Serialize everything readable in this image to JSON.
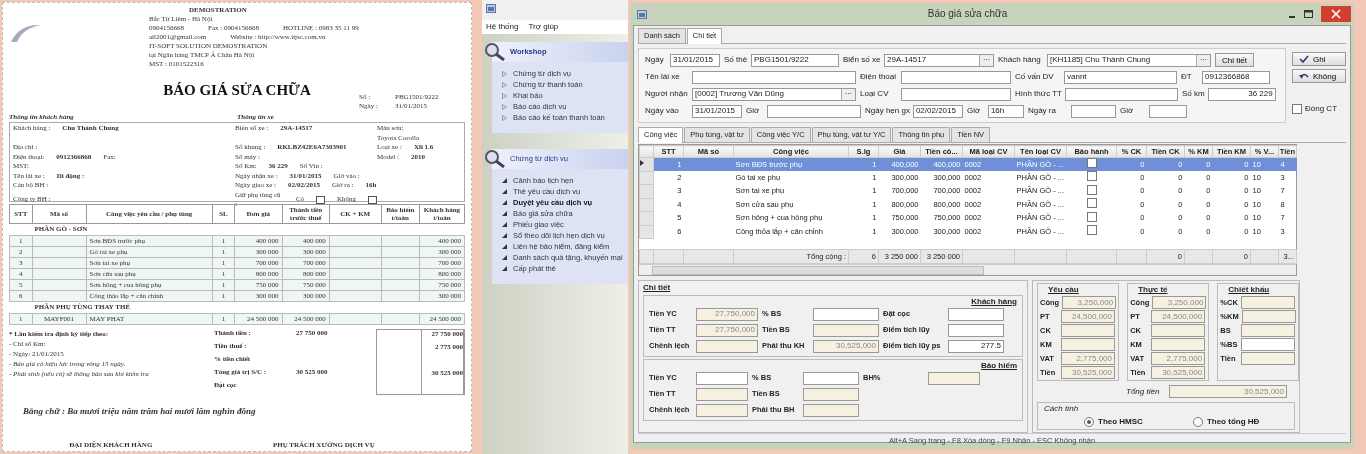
{
  "document": {
    "company_rows": [
      [
        "DEMOSTRATION"
      ],
      [
        "Bắc Từ Liêm - Hà Nội"
      ],
      [
        "0904156668",
        "Fax : 0904156668",
        "HOTLINE : 0983 35 11 99"
      ],
      [
        "ail2001@gmail.com",
        "Website : http://www.itjsc.com.vn"
      ],
      [
        "IT-SOFT SOLUTION DEMOSTRATION"
      ],
      [
        "tại Ngân hàng TMCP Á Châu Hà Nội"
      ],
      [
        "MST : 0101522316"
      ]
    ],
    "title": "BÁO GIÁ SỬA CHỮA",
    "meta": [
      [
        "Số :",
        "PBG1501/9222"
      ],
      [
        "Ngày :",
        "31/01/2015"
      ]
    ],
    "customer_heading": "Thông tin khách hàng",
    "vehicle_heading": "Thông tin xe",
    "info_rows": [
      {
        "customer": [
          "Khách hàng :",
          "Chu Thành Chung"
        ],
        "vehicle": [
          "Biển số xe :",
          "29A-14517"
        ],
        "extra": [
          "Màu sơn:"
        ]
      },
      {
        "extra": [
          "Toyota Corolla"
        ]
      },
      {
        "customer": [
          "Địa chỉ :"
        ],
        "vehicle": [
          "Số khung :",
          "RKLBZ42E6A7303901"
        ],
        "extra": [
          "Loại xe :",
          "Xli 1.6"
        ]
      },
      {
        "customer": [
          "Điện thoại:",
          "0912366868",
          "Fax:"
        ],
        "vehicle": [
          "Số máy :"
        ],
        "extra": [
          "Model :",
          "2010"
        ]
      },
      {
        "customer": [
          "MST:"
        ],
        "vehicle": [
          "Số Km:",
          "36 229",
          "Số Vin :"
        ]
      },
      {
        "customer": [
          "Tên lái xe :",
          "Di động :"
        ],
        "vehicle": [
          "Ngày nhận xe :",
          "31/01/2015",
          "Giờ vào :"
        ]
      },
      {
        "customer": [
          "Cán bộ BH :"
        ],
        "vehicle": [
          "Ngày giao xe :",
          "02/02/2015",
          "Giờ ra :",
          "16h"
        ]
      },
      {
        "customer": [
          "Công ty BH :"
        ],
        "vehicle": [
          "Giữ phụ tùng cũ :"
        ],
        "boxes": [
          {
            "label": "Có",
            "checked": false
          },
          {
            "label": "Không",
            "checked": false
          }
        ]
      }
    ],
    "columns": [
      "STT",
      "Mã số",
      "Công việc yêu cầu / phụ tùng",
      "SL",
      "Đơn giá",
      "Thành tiền trước thuế",
      "CK + KM",
      "Bảo hiểm t/toán",
      "Khách hàng t/toán"
    ],
    "groups": [
      {
        "title": "PHẦN GÒ - SƠN",
        "rows": [
          {
            "stt": "1",
            "name": "Sơn BĐS trước phụ",
            "qty": "1",
            "price": "400 000",
            "amount": "400 000",
            "customer_pay": "400 000"
          },
          {
            "stt": "2",
            "name": "Gò tai xe phụ",
            "qty": "1",
            "price": "300 000",
            "amount": "300 000",
            "customer_pay": "300 000"
          },
          {
            "stt": "3",
            "name": "Sơn tai xe phụ",
            "qty": "1",
            "price": "700 000",
            "amount": "700 000",
            "customer_pay": "700 000"
          },
          {
            "stt": "4",
            "name": "Sơn cửa sau phụ",
            "qty": "1",
            "price": "800 000",
            "amount": "800 000",
            "customer_pay": "800 000"
          },
          {
            "stt": "5",
            "name": "Sơn hông + cua hông phụ",
            "qty": "1",
            "price": "750 000",
            "amount": "750 000",
            "customer_pay": "750 000"
          },
          {
            "stt": "6",
            "name": "Công thảo lắp + căn chỉnh",
            "qty": "1",
            "price": "300 000",
            "amount": "300 000",
            "customer_pay": "300 000"
          }
        ]
      },
      {
        "title": "PHẦN PHỤ TÙNG THAY THẾ",
        "rows": [
          {
            "stt": "1",
            "code": "MAYF001",
            "name": "MAY PHAT",
            "qty": "1",
            "price": "24 500 000",
            "amount": "24 500 000",
            "customer_pay": "24 500 000"
          }
        ]
      }
    ],
    "notes": [
      "* Lần kiểm tra định kỳ tiếp theo:",
      "- Chỉ số Km:",
      "- Ngày:  21/01/2015",
      "- Báo giá có hiệu lực trong vòng 15 ngày.",
      "- Phát sinh (nếu có) sẽ thông báo sau khi kiểm tra"
    ],
    "totals": [
      {
        "label": "Thành tiền :",
        "value": "27 750 000",
        "box": "27 750 000"
      },
      {
        "label": "Tiền thuế :",
        "box": "2 775 000"
      },
      {
        "label": "% tiền chiết"
      },
      {
        "label": "Tổng giá trị S/C :",
        "value": "30 525 000",
        "box": "30 525 000"
      },
      {
        "label": "Đặt cọc"
      }
    ],
    "in_words": "Bằng chữ :  Ba mươi triệu năm trăm hai mươi lăm nghìn đồng",
    "signatures": [
      "ĐẠI DIỆN KHÁCH HÀNG",
      "PHỤ TRÁCH XƯỞNG DỊCH VỤ"
    ]
  },
  "nav_app": {
    "menu": [
      "Hệ thống",
      "Trợ giúp"
    ],
    "panels": [
      {
        "title": "Workshop",
        "kind": "outline",
        "items": [
          {
            "label": "Chứng từ dịch vụ",
            "selected": false
          },
          {
            "label": "Chứng từ thanh toán",
            "selected": false
          },
          {
            "label": "Khai báo",
            "selected": false
          },
          {
            "label": "Báo cáo dịch vụ",
            "selected": false
          },
          {
            "label": "Báo cáo kế toán thanh toán",
            "selected": false
          }
        ]
      },
      {
        "title": "Chứng từ dịch vụ",
        "kind": "solid",
        "items": [
          {
            "label": "Cảnh báo lịch hẹn",
            "selected": false
          },
          {
            "label": "Thẻ yêu cầu dịch vụ",
            "selected": false
          },
          {
            "label": "Duyệt yêu cầu dịch vụ",
            "selected": true
          },
          {
            "label": "Báo giá sửa chữa",
            "selected": false
          },
          {
            "label": "Phiếu giao việc",
            "selected": false
          },
          {
            "label": "Sổ theo dõi lịch hẹn dịch vụ",
            "selected": false
          },
          {
            "label": "Liên hệ bảo hiểm, đăng kiểm",
            "selected": false
          },
          {
            "label": "Danh sách quà tặng, khuyến mại",
            "selected": false
          },
          {
            "label": "Cấp phát thẻ",
            "selected": false
          }
        ]
      }
    ]
  },
  "window": {
    "title": "Báo giá sửa chữa",
    "tabs": [
      {
        "label": "Danh sách",
        "selected": false
      },
      {
        "label": "Chi tiết",
        "selected": true
      }
    ],
    "form_rows": [
      [
        {
          "label": "Ngày",
          "value": "31/01/2015",
          "kind": "text"
        },
        {
          "label": "Số thẻ",
          "value": "PBG1501/9222",
          "kind": "text"
        },
        {
          "label": "Biển số xe",
          "value": "29A-14517",
          "kind": "lookup",
          "button": "···"
        },
        {
          "label": "Khách hàng",
          "value": "[KH1185] Chu Thành Chung",
          "kind": "lookup",
          "button": "···"
        }
      ],
      [
        {
          "label": "Tên lái xe",
          "kind": "text"
        },
        {
          "label": "Điện thoại",
          "kind": "text"
        },
        {
          "label": "Cố vấn DV",
          "value": "vannt",
          "kind": "text"
        },
        {
          "label": "ĐT",
          "value": "0912366868",
          "kind": "text"
        }
      ],
      [
        {
          "label": "Người nhận",
          "value": "[0002] Trương Văn Dũng",
          "kind": "lookup",
          "button": "···"
        },
        {
          "label": "Loại CV",
          "kind": "text"
        },
        {
          "label": "Hình thức TT",
          "kind": "text"
        },
        {
          "label": "Số km",
          "value": "36 229",
          "kind": "number"
        }
      ],
      [
        {
          "label": "Ngày vào",
          "value": "31/01/2015",
          "kind": "text"
        },
        {
          "label": "Giờ",
          "kind": "text"
        },
        {
          "label": "Ngày hẹn gx",
          "value": "02/02/2015",
          "kind": "text"
        },
        {
          "label": "Giờ",
          "value": "16h",
          "kind": "text"
        },
        {
          "label": "Ngày ra",
          "kind": "text"
        },
        {
          "label": "Giờ",
          "kind": "text"
        }
      ]
    ],
    "detail_button": "Chi tiết",
    "actions": [
      "Ghi",
      "Không"
    ],
    "close_doc": {
      "label": "Đóng CT",
      "checked": false
    },
    "inner_tabs": [
      {
        "label": "Công việc",
        "selected": true
      },
      {
        "label": "Phụ tùng, vật tư",
        "selected": false
      },
      {
        "label": "Công việc Y/C",
        "selected": false
      },
      {
        "label": "Phụ tùng, vật tư Y/C",
        "selected": false
      },
      {
        "label": "Thông tin phụ",
        "selected": false
      },
      {
        "label": "Tiền NV",
        "selected": false
      }
    ],
    "grid": {
      "columns": [
        "STT",
        "Mã số",
        "Công việc",
        "S.lg",
        "Giá",
        "Tiền cô...",
        "Mã loại CV",
        "Tên loại CV",
        "Bảo hành",
        "% CK",
        "Tiền CK",
        "% KM",
        "Tiền KM",
        "% V...",
        "Tiền"
      ],
      "rows": [
        {
          "stt": "1",
          "task": "Sơn BĐS trước phụ",
          "qty": "1",
          "price": "400,000",
          "labor": "400,000",
          "type_code": "0002",
          "type_name": "PHẦN GÒ - ...",
          "warranty": false,
          "ck_pct": "0",
          "ck": "0",
          "km_pct": "0",
          "km": "0",
          "vat_pct": "10",
          "column_15": "4",
          "selected": true
        },
        {
          "stt": "2",
          "task": "Gò tai xe phụ",
          "qty": "1",
          "price": "300,000",
          "labor": "300,000",
          "type_code": "0002",
          "type_name": "PHẦN GÒ - ...",
          "warranty": false,
          "ck_pct": "0",
          "ck": "0",
          "km_pct": "0",
          "km": "0",
          "vat_pct": "10",
          "column_15": "3",
          "selected": false
        },
        {
          "stt": "3",
          "task": "Sơn tai xe phụ",
          "qty": "1",
          "price": "700,000",
          "labor": "700,000",
          "type_code": "0002",
          "type_name": "PHẦN GÒ - ...",
          "warranty": false,
          "ck_pct": "0",
          "ck": "0",
          "km_pct": "0",
          "km": "0",
          "vat_pct": "10",
          "column_15": "7",
          "selected": false
        },
        {
          "stt": "4",
          "task": "Sơn cửa sau phụ",
          "qty": "1",
          "price": "800,000",
          "labor": "800,000",
          "type_code": "0002",
          "type_name": "PHẦN GÒ - ...",
          "warranty": false,
          "ck_pct": "0",
          "ck": "0",
          "km_pct": "0",
          "km": "0",
          "vat_pct": "10",
          "column_15": "8",
          "selected": false
        },
        {
          "stt": "5",
          "task": "Sơn hông + cua hông phụ",
          "qty": "1",
          "price": "750,000",
          "labor": "750,000",
          "type_code": "0002",
          "type_name": "PHẦN GÒ - ...",
          "warranty": false,
          "ck_pct": "0",
          "ck": "0",
          "km_pct": "0",
          "km": "0",
          "vat_pct": "10",
          "column_15": "7",
          "selected": false
        },
        {
          "stt": "6",
          "task": "Công thỏa lắp + căn chỉnh",
          "qty": "1",
          "price": "300,000",
          "labor": "300,000",
          "type_code": "0002",
          "type_name": "PHẦN GÒ - ...",
          "warranty": false,
          "ck_pct": "0",
          "ck": "0",
          "km_pct": "0",
          "km": "0",
          "vat_pct": "10",
          "column_15": "3",
          "selected": false
        }
      ],
      "totals": {
        "task": "Tổng cộng :",
        "qty": "6",
        "price": "3 250 000",
        "labor": "3 250 000",
        "ck": "0",
        "km": "0",
        "column_15": "3..."
      }
    },
    "detail_title": "Chi tiết",
    "customer": {
      "title": "Khách hàng",
      "rows": [
        [
          {
            "label": "Tiền YC",
            "value": "27,750,000",
            "disabled": true
          },
          {
            "label": "% BS",
            "disabled": false
          },
          {
            "label": "Đặt cọc",
            "disabled": false
          }
        ],
        [
          {
            "label": "Tiền TT",
            "value": "27,750,000",
            "disabled": true
          },
          {
            "label": "Tiền BS",
            "disabled": true
          },
          {
            "label": "Điểm tích lũy",
            "disabled": false
          }
        ],
        [
          {
            "label": "Chênh lệch",
            "disabled": true
          },
          {
            "label": "Phải thu KH",
            "value": "30,525,000",
            "disabled": true
          },
          {
            "label": "Điểm tích lũy ps",
            "value": "277.5",
            "disabled": false
          }
        ]
      ]
    },
    "insurance": {
      "title": "Bảo hiểm",
      "rows": [
        [
          {
            "label": "Tiền YC",
            "disabled": false
          },
          {
            "label": "% BS",
            "disabled": false
          },
          {
            "label": "BH%",
            "disabled": true
          }
        ],
        [
          {
            "label": "Tiền TT",
            "disabled": true
          },
          {
            "label": "Tiền BS",
            "disabled": true
          }
        ],
        [
          {
            "label": "Chênh lệch",
            "disabled": true
          },
          {
            "label": "Phải thu BH",
            "disabled": true
          }
        ]
      ]
    },
    "summary": [
      {
        "title": "Yêu cầu",
        "rows": [
          {
            "label": "Công",
            "value": "3,250,000",
            "disabled": true
          },
          {
            "label": "PT",
            "value": "24,500,000",
            "disabled": true
          },
          {
            "label": "CK",
            "disabled": true
          },
          {
            "label": "KM",
            "disabled": true
          },
          {
            "label": "VAT",
            "value": "2,775,000",
            "disabled": true
          },
          {
            "label": "Tiền",
            "value": "30,525,000",
            "disabled": true
          }
        ]
      },
      {
        "title": "Thực tế",
        "rows": [
          {
            "label": "Công",
            "value": "3,250,000",
            "disabled": true
          },
          {
            "label": "PT",
            "value": "24,500,000",
            "disabled": true
          },
          {
            "label": "CK",
            "disabled": true
          },
          {
            "label": "KM",
            "disabled": true
          },
          {
            "label": "VAT",
            "value": "2,775,000",
            "disabled": true
          },
          {
            "label": "Tiền",
            "value": "30,525,000",
            "disabled": true
          }
        ]
      },
      {
        "title": "Chiết khấu",
        "rows": [
          {
            "label": "%CK",
            "disabled": true
          },
          {
            "label": "%KM",
            "disabled": true
          },
          {
            "label": "BS",
            "disabled": true
          },
          {
            "label": "%BS",
            "disabled": false
          },
          {
            "label": "Tiền",
            "disabled": true
          }
        ]
      }
    ],
    "grand_total": {
      "label": "Tổng tiền",
      "value": "30,525,000",
      "disabled": true
    },
    "method": {
      "title": "Cách tính",
      "options": [
        {
          "label": "Theo HMSC",
          "selected": true
        },
        {
          "label": "Theo tổng HĐ",
          "selected": false
        }
      ]
    },
    "status_bar": "Alt+A Sang trang - F8 Xóa dòng - F9 Nhận - ESC Không nhận"
  }
}
